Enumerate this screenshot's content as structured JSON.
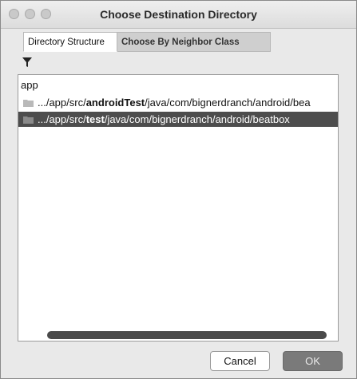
{
  "window": {
    "title": "Choose Destination Directory"
  },
  "tabs": [
    {
      "label": "Directory Structure",
      "active": true
    },
    {
      "label": "Choose By Neighbor Class",
      "active": false
    }
  ],
  "toolbar": {
    "filter_icon": "filter-icon"
  },
  "tree": {
    "root_label": "app",
    "rows": [
      {
        "icon": "folder-icon",
        "prefix": ".../app/src/",
        "bold": "androidTest",
        "suffix": "/java/com/bignerdranch/android/bea",
        "selected": false
      },
      {
        "icon": "folder-icon",
        "prefix": ".../app/src/",
        "bold": "test",
        "suffix": "/java/com/bignerdranch/android/beatbox",
        "selected": true
      }
    ]
  },
  "buttons": {
    "cancel": "Cancel",
    "ok": "OK"
  },
  "colors": {
    "selection": "#4d4d4d",
    "ok_button": "#7a7a7a"
  }
}
